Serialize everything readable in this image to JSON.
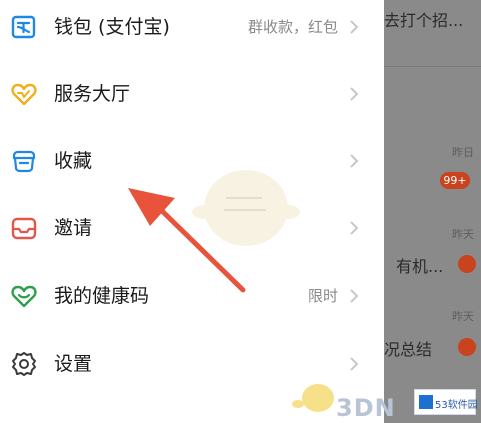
{
  "menu": {
    "items": [
      {
        "label": "钱包 (支付宝)",
        "extra": "群收款，红包",
        "icon": "wallet-icon"
      },
      {
        "label": "服务大厅",
        "extra": "",
        "icon": "service-hall-icon"
      },
      {
        "label": "收藏",
        "extra": "",
        "icon": "favorites-icon"
      },
      {
        "label": "邀请",
        "extra": "",
        "icon": "invite-icon"
      },
      {
        "label": "我的健康码",
        "extra": "限时",
        "icon": "health-code-icon"
      },
      {
        "label": "设置",
        "extra": "",
        "icon": "settings-gear-icon"
      }
    ]
  },
  "background": {
    "texts": [
      "去打个招...",
      "有机...",
      "况总结"
    ],
    "times": [
      "昨日",
      "昨天",
      "昨天"
    ],
    "badge": "99+"
  },
  "watermarks": {
    "text_3dm": "3DN",
    "site_logo": "53软件园"
  },
  "colors": {
    "accent_blue": "#1e88e5",
    "health_green": "#2e9f4c",
    "service_yellow": "#f0b21b",
    "invite_red": "#e2574c",
    "arrow_red": "#e8533b"
  }
}
